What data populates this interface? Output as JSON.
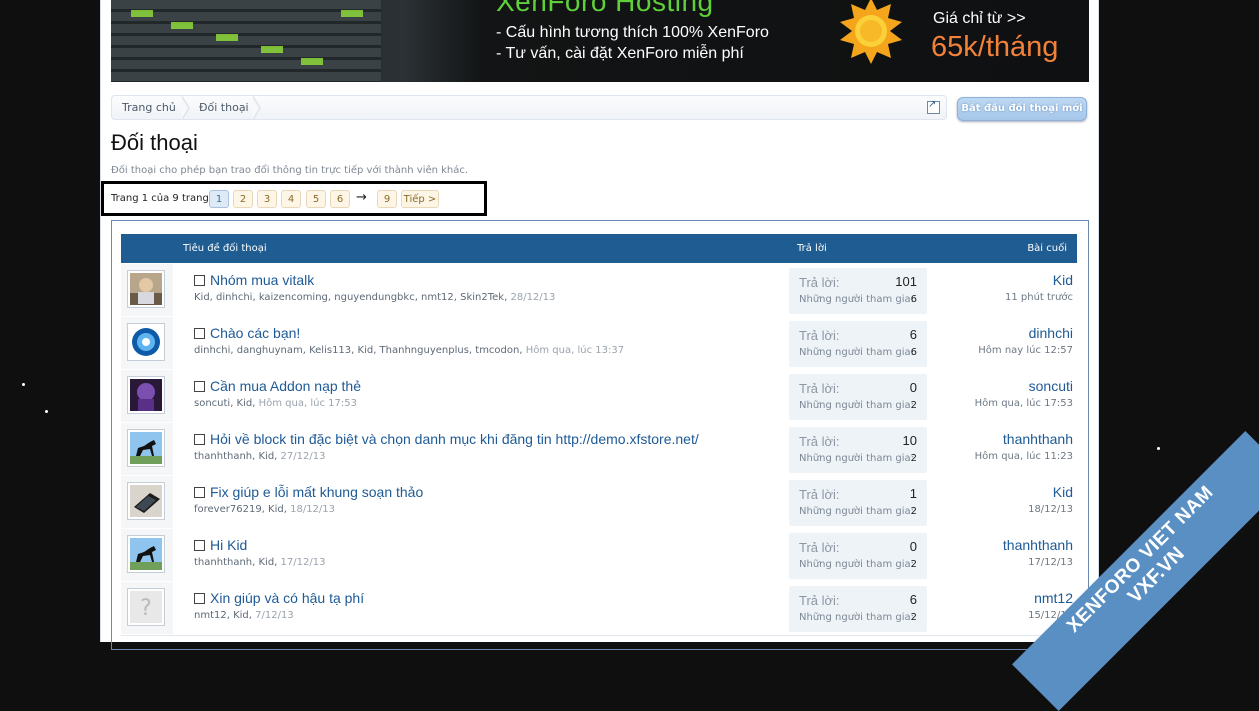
{
  "banner": {
    "title": "XenForo Hosting",
    "line1": "- Cấu hình tương thích 100% XenForo",
    "line2": "- Tư vấn, cài đặt XenForo miễn phí",
    "price_label": "Giá chỉ từ >>",
    "price_value": "65k/tháng"
  },
  "breadcrumb": [
    "Trang chủ",
    "Đối thoại"
  ],
  "start_button": "Bắt đầu đối thoại mới",
  "page_title": "Đối thoại",
  "description": "Đối thoại cho phép bạn trao đổi thông tin trực tiếp với thành viên khác.",
  "pagination": {
    "label": "Trang 1 của 9 trang",
    "pages": [
      "1",
      "2",
      "3",
      "4",
      "5",
      "6",
      "9"
    ],
    "current": "1",
    "arrow": "→",
    "next": "Tiếp >"
  },
  "list_header": {
    "title": "Tiêu đề đối thoại",
    "replies": "Trả lời",
    "last": "Bài cuối"
  },
  "labels": {
    "replies": "Trả lời:",
    "participants": "Những người tham gia:"
  },
  "conversations": [
    {
      "title": "Nhóm mua vitalk",
      "members": "Kid, dinhchi, kaizencoming, nguyendungbkc, nmt12, Skin2Tek,",
      "date": "28/12/13",
      "replies": "101",
      "participants": "6",
      "last_user": "Kid",
      "last_date": "11 phút trước",
      "avatar": "photo-person-icon"
    },
    {
      "title": "Chào các bạn!",
      "members": "dinhchi, danghuynam, Kelis113, Kid, Thanhnguyenplus, tmcodon,",
      "date": "Hôm qua, lúc 13:37",
      "replies": "6",
      "participants": "6",
      "last_user": "dinhchi",
      "last_date": "Hôm nay lúc 12:57",
      "avatar": "blue-swirl-icon"
    },
    {
      "title": "Cần mua Addon nạp thẻ",
      "members": "soncuti, Kid,",
      "date": "Hôm qua, lúc 17:53",
      "replies": "0",
      "participants": "2",
      "last_user": "soncuti",
      "last_date": "Hôm qua, lúc 17:53",
      "avatar": "purple-character-icon"
    },
    {
      "title": "Hỏi về block tin đặc biệt và chọn danh mục khi đăng tin http://demo.xfstore.net/",
      "members": "thanhthanh, Kid,",
      "date": "27/12/13",
      "replies": "10",
      "participants": "2",
      "last_user": "thanhthanh",
      "last_date": "Hôm qua, lúc 11:23",
      "avatar": "black-horse-icon"
    },
    {
      "title": "Fix giúp e lỗi mất khung soạn thảo",
      "members": "forever76219, Kid,",
      "date": "18/12/13",
      "replies": "1",
      "participants": "2",
      "last_user": "Kid",
      "last_date": "18/12/13",
      "avatar": "dark-laptop-icon"
    },
    {
      "title": "Hi Kid",
      "members": "thanhthanh, Kid,",
      "date": "17/12/13",
      "replies": "0",
      "participants": "2",
      "last_user": "thanhthanh",
      "last_date": "17/12/13",
      "avatar": "black-horse-icon"
    },
    {
      "title": "Xin giúp và có hậu tạ phí",
      "members": "nmt12, Kid,",
      "date": "7/12/13",
      "replies": "6",
      "participants": "2",
      "last_user": "nmt12",
      "last_date": "15/12/13",
      "avatar": "default-avatar-icon"
    }
  ],
  "watermark": {
    "line1": "XENFORO VIET NAM",
    "line2": "VXF.VN"
  }
}
